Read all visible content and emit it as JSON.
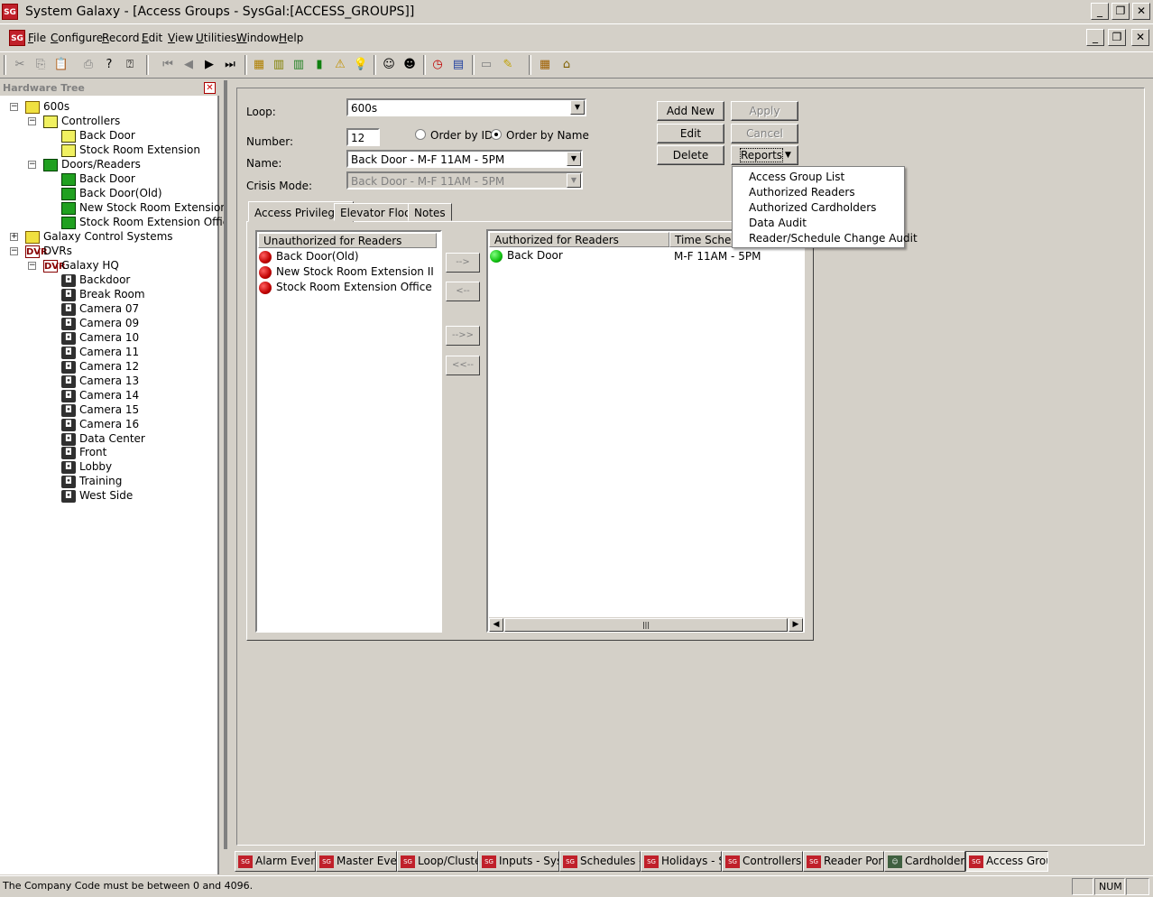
{
  "window": {
    "title": "System Galaxy - [Access Groups - SysGal:[ACCESS_GROUPS]]",
    "icon_text": "SG"
  },
  "menu": {
    "items": [
      "File",
      "Configure",
      "Record",
      "Edit",
      "View",
      "Utilities",
      "Window",
      "Help"
    ]
  },
  "tree": {
    "header": "Hardware Tree",
    "nodes": [
      {
        "label": "600s",
        "icon": "loop-icon"
      },
      {
        "label": "Controllers",
        "icon": "controller-icon"
      },
      {
        "label": "Back Door",
        "icon": "controller-icon"
      },
      {
        "label": "Stock Room Extension",
        "icon": "controller-icon"
      },
      {
        "label": "Doors/Readers",
        "icon": "door-icon"
      },
      {
        "label": "Back Door",
        "icon": "door-icon"
      },
      {
        "label": "Back Door(Old)",
        "icon": "door-icon"
      },
      {
        "label": "New Stock Room Extension II",
        "icon": "door-icon"
      },
      {
        "label": "Stock Room Extension Office",
        "icon": "door-icon"
      },
      {
        "label": "Galaxy Control Systems",
        "icon": "loop-icon"
      },
      {
        "label": "DVRs",
        "icon": "dvr-icon"
      },
      {
        "label": "Galaxy HQ",
        "icon": "dvr-icon"
      },
      {
        "label": "Backdoor",
        "icon": "camera-icon"
      },
      {
        "label": "Break Room",
        "icon": "camera-icon"
      },
      {
        "label": "Camera 07",
        "icon": "camera-icon"
      },
      {
        "label": "Camera 09",
        "icon": "camera-icon"
      },
      {
        "label": "Camera 10",
        "icon": "camera-icon"
      },
      {
        "label": "Camera 11",
        "icon": "camera-icon"
      },
      {
        "label": "Camera 12",
        "icon": "camera-icon"
      },
      {
        "label": "Camera 13",
        "icon": "camera-icon"
      },
      {
        "label": "Camera 14",
        "icon": "camera-icon"
      },
      {
        "label": "Camera 15",
        "icon": "camera-icon"
      },
      {
        "label": "Camera 16",
        "icon": "camera-icon"
      },
      {
        "label": "Data Center",
        "icon": "camera-icon"
      },
      {
        "label": "Front",
        "icon": "camera-icon"
      },
      {
        "label": "Lobby",
        "icon": "camera-icon"
      },
      {
        "label": "Training",
        "icon": "camera-icon"
      },
      {
        "label": "West Side",
        "icon": "camera-icon"
      }
    ]
  },
  "form": {
    "loop_label": "Loop:",
    "loop_value": "600s",
    "number_label": "Number:",
    "number_value": "12",
    "order_by_id": "Order by ID",
    "order_by_name": "Order by Name",
    "name_label": "Name:",
    "name_value": "Back Door - M-F 11AM - 5PM",
    "crisis_label": "Crisis Mode:",
    "crisis_value": "Back Door - M-F 11AM - 5PM"
  },
  "buttons": {
    "add_new": "Add New",
    "apply": "Apply",
    "edit": "Edit",
    "cancel": "Cancel",
    "delete": "Delete",
    "reports": "Reports"
  },
  "reports_menu": [
    "Access Group List",
    "Authorized Readers",
    "Authorized Cardholders",
    "Data Audit",
    "Reader/Schedule Change Audit"
  ],
  "tabs": [
    "Access Privileges",
    "Elevator Floors",
    "Notes"
  ],
  "unauthorized": {
    "header": "Unauthorized for Readers",
    "items": [
      "Back Door(Old)",
      "New Stock Room Extension II",
      "Stock Room Extension Office"
    ]
  },
  "authorized": {
    "header": "Authorized for Readers",
    "header2": "Time Schedule",
    "rows": [
      {
        "reader": "Back Door",
        "schedule": "M-F 11AM - 5PM"
      }
    ]
  },
  "move_buttons": [
    "-->",
    "<--",
    "-->>",
    "<<--"
  ],
  "task_tabs": [
    "Alarm Events",
    "Master Eve...",
    "Loop/Cluste...",
    "Inputs - Sys...",
    "Schedules -...",
    "Holidays - S...",
    "Controllers - ...",
    "Reader Port...",
    "Cardholders...",
    "Access Grou..."
  ],
  "status": {
    "message": "The Company Code must be between 0 and 4096.",
    "num": "NUM"
  }
}
